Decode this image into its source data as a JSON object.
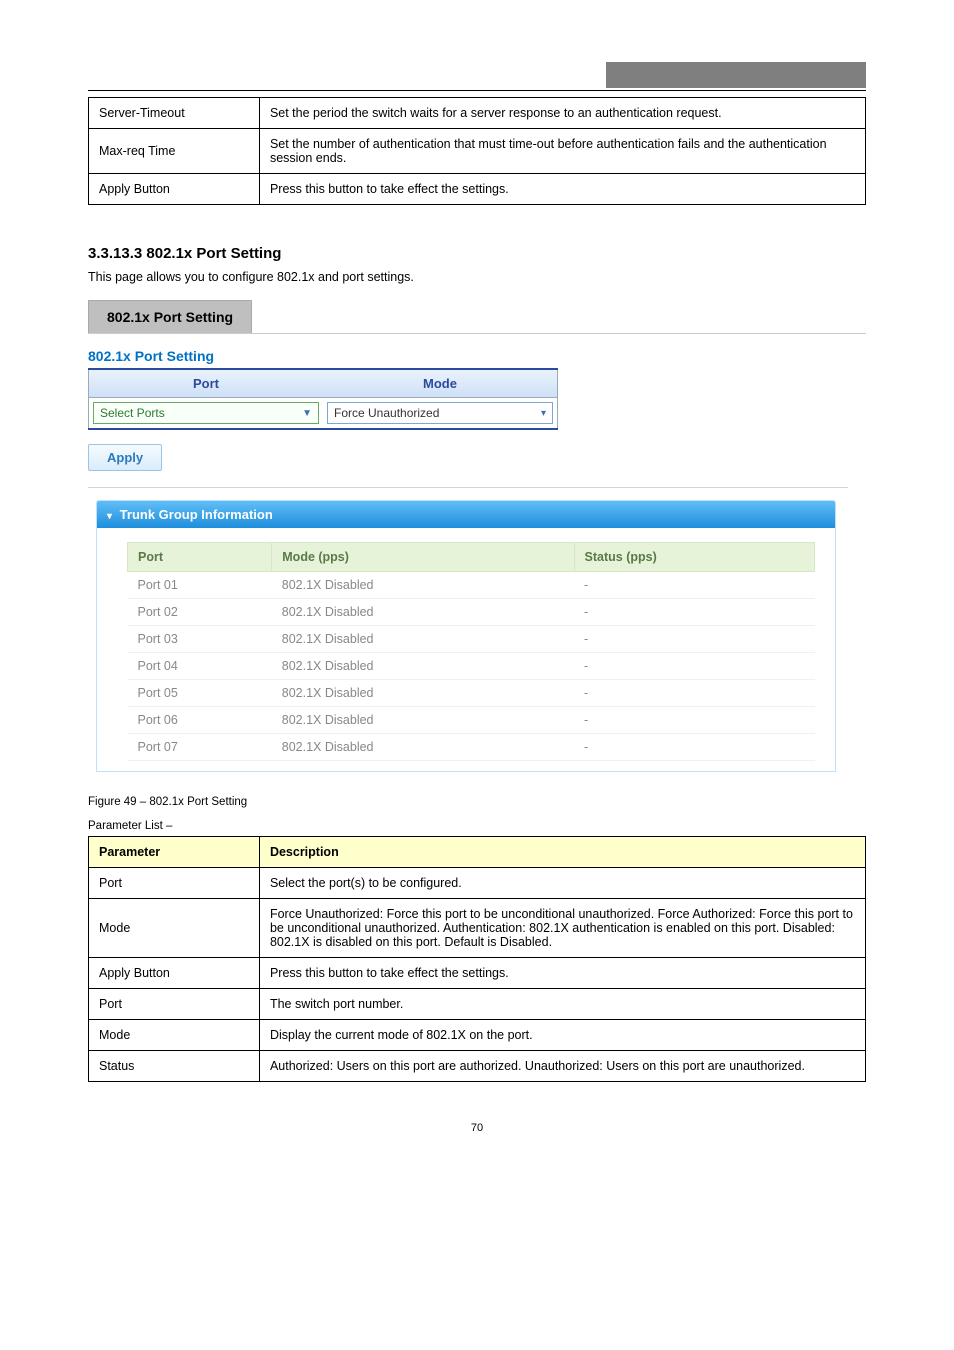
{
  "top_table": {
    "rows": [
      {
        "key": "Server-Timeout",
        "val": "Set the period the switch waits for a server response to an authentication request."
      },
      {
        "key": "Max-req Time",
        "val": "Set the number of authentication that must time-out before authentication fails and the authentication session ends."
      },
      {
        "key": "Apply Button",
        "val": "Press this button to take effect the settings."
      }
    ]
  },
  "section": {
    "num_title": "3.3.13.3 802.1x Port Setting",
    "desc": "This page allows you to configure 802.1x and port settings."
  },
  "embed1": {
    "tab_label": "802.1x Port Setting",
    "heading": "802.1x Port Setting",
    "col_port": "Port",
    "col_mode": "Mode",
    "port_select_placeholder": "Select Ports",
    "mode_value": "Force Unauthorized",
    "apply_label": "Apply"
  },
  "panel": {
    "title": "Trunk Group Information",
    "cols": {
      "port": "Port",
      "mode": "Mode (pps)",
      "status": "Status (pps)"
    },
    "rows": [
      {
        "port": "Port 01",
        "mode": "802.1X Disabled",
        "status": "-"
      },
      {
        "port": "Port 02",
        "mode": "802.1X Disabled",
        "status": "-"
      },
      {
        "port": "Port 03",
        "mode": "802.1X Disabled",
        "status": "-"
      },
      {
        "port": "Port 04",
        "mode": "802.1X Disabled",
        "status": "-"
      },
      {
        "port": "Port 05",
        "mode": "802.1X Disabled",
        "status": "-"
      },
      {
        "port": "Port 06",
        "mode": "802.1X Disabled",
        "status": "-"
      },
      {
        "port": "Port 07",
        "mode": "802.1X Disabled",
        "status": "-"
      }
    ]
  },
  "fig_caption": "Figure 49 – 802.1x Port Setting",
  "param_list_caption": "Parameter List –",
  "params2": {
    "hdr_param": "Parameter",
    "hdr_desc": "Description",
    "rows": [
      {
        "key": "Port",
        "val": "Select the port(s) to be configured."
      },
      {
        "key": "Mode",
        "val": "Force Unauthorized: Force this port to be unconditional unauthorized. Force Authorized: Force this port to be unconditional unauthorized. Authentication: 802.1X authentication is enabled on this port. Disabled: 802.1X is disabled on this port. Default is Disabled."
      },
      {
        "key": "Apply Button",
        "val": "Press this button to take effect the settings."
      },
      {
        "key": "Port",
        "val": "The switch port number."
      },
      {
        "key": "Mode",
        "val": "Display the current mode of 802.1X on the port."
      },
      {
        "key": "Status",
        "val": "Authorized: Users on this port are authorized. Unauthorized: Users on this port are unauthorized."
      }
    ]
  },
  "page_number": "70"
}
